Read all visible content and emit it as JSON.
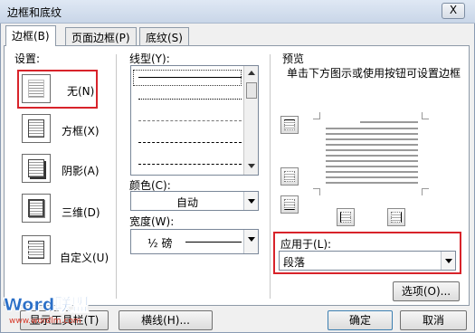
{
  "window": {
    "title": "边框和底纹",
    "close_glyph": "X"
  },
  "tabs": [
    {
      "label": "边框(B)",
      "active": true
    },
    {
      "label": "页面边框(P)",
      "active": false
    },
    {
      "label": "底纹(S)",
      "active": false
    }
  ],
  "settings": {
    "heading": "设置:",
    "items": [
      {
        "label": "无(N)",
        "selected": true
      },
      {
        "label": "方框(X)",
        "selected": false
      },
      {
        "label": "阴影(A)",
        "selected": false
      },
      {
        "label": "三维(D)",
        "selected": false
      },
      {
        "label": "自定义(U)",
        "selected": false
      }
    ]
  },
  "style": {
    "heading": "线型(Y):",
    "options": [
      "solid",
      "dotted",
      "dashed-fine",
      "dashed",
      "dash-dot"
    ],
    "selected": "solid"
  },
  "color": {
    "label": "颜色(C):",
    "value": "自动"
  },
  "width": {
    "label": "宽度(W):",
    "value": "½ 磅"
  },
  "preview": {
    "heading": "预览",
    "instruction": "单击下方图示或使用按钮可设置边框"
  },
  "apply_to": {
    "label": "应用于(L):",
    "value": "段落"
  },
  "buttons": {
    "options": "选项(O)...",
    "horizontal_line": "横线(H)...",
    "show_toolbar": "显示工具栏(T)",
    "ok": "确定",
    "cancel": "取消"
  },
  "watermark": {
    "brand": "Word联盟",
    "url": "www.wordlm.com"
  },
  "colors": {
    "highlight": "#d8232a",
    "watermark_blue": "#2b6fc7",
    "watermark_red": "#d63a2a"
  }
}
